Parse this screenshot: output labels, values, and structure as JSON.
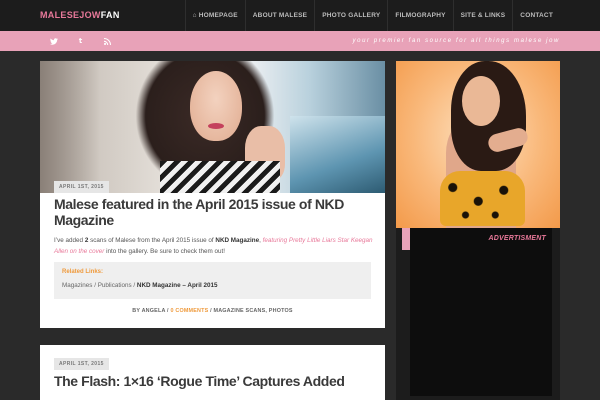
{
  "site": {
    "logo_part1": "MALESEJOW",
    "logo_part2": "FAN",
    "tagline": "your premier fan source for all things malese jow"
  },
  "nav": {
    "items": [
      {
        "label": "HOMEPAGE",
        "icon": "home-icon"
      },
      {
        "label": "ABOUT MALESE"
      },
      {
        "label": "PHOTO GALLERY"
      },
      {
        "label": "FILMOGRAPHY"
      },
      {
        "label": "SITE & LINKS"
      },
      {
        "label": "CONTACT"
      }
    ]
  },
  "social": {
    "twitter_glyph": "❦",
    "tumblr_glyph": "t",
    "rss_glyph": "☰"
  },
  "posts": [
    {
      "date": "APRIL 1ST, 2015",
      "title": "Malese featured in the April 2015 issue of NKD Magazine",
      "body_1": "I’ve added ",
      "body_count": "2",
      "body_2": " scans of Malese from the April 2015 issue of ",
      "body_mag": "NKD Magazine",
      "body_3": ", ",
      "body_link": "featuring Pretty Little Liars Star Keegan Allen on the cover",
      "body_4": " into the gallery. Be sure to check them out!",
      "related_title": "Related Links:",
      "related_path": "Magazines / Publications / ",
      "related_item": "NKD Magazine – April 2015",
      "meta_author": "BY ANGELA / ",
      "meta_comments": "0 COMMENTS",
      "meta_tags": " / MAGAZINE SCANS, PHOTOS"
    },
    {
      "date": "APRIL 1ST, 2015",
      "title": "The Flash: 1×16 ‘Rogue Time’ Captures Added"
    }
  ],
  "sidebar": {
    "ad_label": "ADVERTISMENT"
  },
  "colors": {
    "accent_pink": "#e8a2b8",
    "link_pink": "#e8799a",
    "orange": "#ef9a3c",
    "nav_bg": "#1c1c1c",
    "page_bg": "#2a2a2a"
  }
}
